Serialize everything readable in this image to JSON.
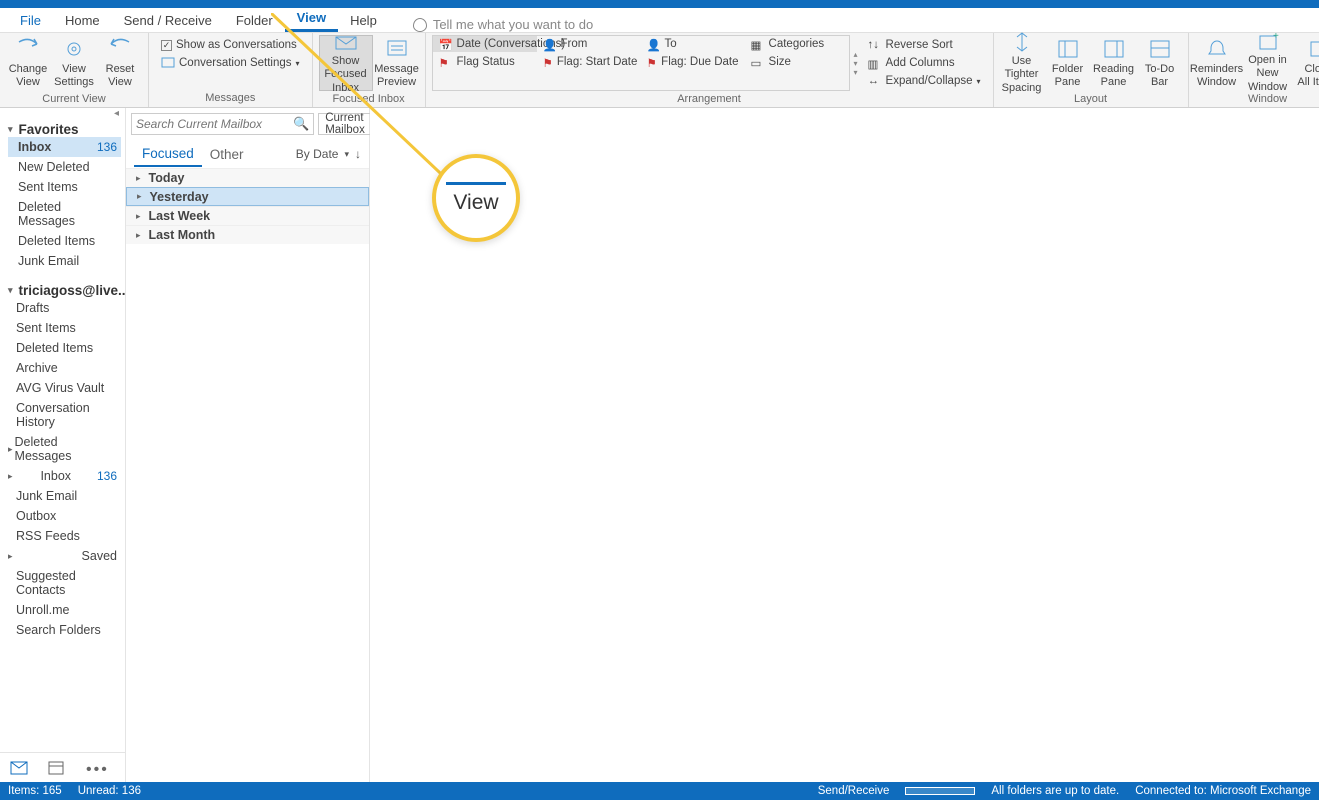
{
  "menubar": {
    "file": "File",
    "home": "Home",
    "sendreceive": "Send / Receive",
    "folder": "Folder",
    "view": "View",
    "help": "Help",
    "tellme": "Tell me what you want to do"
  },
  "ribbon": {
    "currentview": {
      "change": "Change\nView",
      "settings": "View\nSettings",
      "reset": "Reset\nView",
      "label": "Current View"
    },
    "messages": {
      "showconv": "Show as Conversations",
      "convset": "Conversation Settings",
      "label": "Messages"
    },
    "focused": {
      "show": "Show Focused\nInbox",
      "preview": "Message\nPreview",
      "label": "Focused Inbox"
    },
    "arrangement": {
      "date": "Date (Conversations)",
      "from": "From",
      "to": "To",
      "flagstatus": "Flag Status",
      "flagstart": "Flag: Start Date",
      "flagdue": "Flag: Due Date",
      "categories": "Categories",
      "size": "Size",
      "reversesort": "Reverse Sort",
      "addcolumns": "Add Columns",
      "expand": "Expand/Collapse",
      "label": "Arrangement"
    },
    "layout": {
      "tighter": "Use Tighter\nSpacing",
      "folder": "Folder\nPane",
      "reading": "Reading\nPane",
      "todo": "To-Do\nBar",
      "label": "Layout"
    },
    "window": {
      "reminders": "Reminders\nWindow",
      "opennew": "Open in New\nWindow",
      "closeall": "Close\nAll Items",
      "label": "Window"
    }
  },
  "nav": {
    "favorites": "Favorites",
    "fav_items": [
      {
        "name": "Inbox",
        "count": "136",
        "sel": true,
        "bold": true
      },
      {
        "name": "New Deleted"
      },
      {
        "name": "Sent Items"
      },
      {
        "name": "Deleted Messages"
      },
      {
        "name": "Deleted Items"
      },
      {
        "name": "Junk Email"
      }
    ],
    "account": "triciagoss@live....",
    "acct_items": [
      {
        "name": "Drafts"
      },
      {
        "name": "Sent Items"
      },
      {
        "name": "Deleted Items"
      },
      {
        "name": "Archive"
      },
      {
        "name": "AVG Virus Vault"
      },
      {
        "name": "Conversation History"
      },
      {
        "name": "Deleted Messages",
        "caret": true
      },
      {
        "name": "Inbox",
        "count": "136",
        "caret": true
      },
      {
        "name": "Junk Email"
      },
      {
        "name": "Outbox"
      },
      {
        "name": "RSS Feeds"
      },
      {
        "name": "Saved",
        "caret": true
      },
      {
        "name": "Suggested Contacts"
      },
      {
        "name": "Unroll.me"
      },
      {
        "name": "Search Folders"
      }
    ]
  },
  "list": {
    "search_placeholder": "Search Current Mailbox",
    "scope": "Current Mailbox",
    "tab_focused": "Focused",
    "tab_other": "Other",
    "sortby": "By Date",
    "groups": [
      {
        "label": "Today"
      },
      {
        "label": "Yesterday",
        "sel": true
      },
      {
        "label": "Last Week"
      },
      {
        "label": "Last Month"
      }
    ]
  },
  "magnifier": "View",
  "status": {
    "items": "Items: 165",
    "unread": "Unread: 136",
    "sendreceive": "Send/Receive",
    "uptodate": "All folders are up to date.",
    "connected": "Connected to: Microsoft Exchange"
  }
}
